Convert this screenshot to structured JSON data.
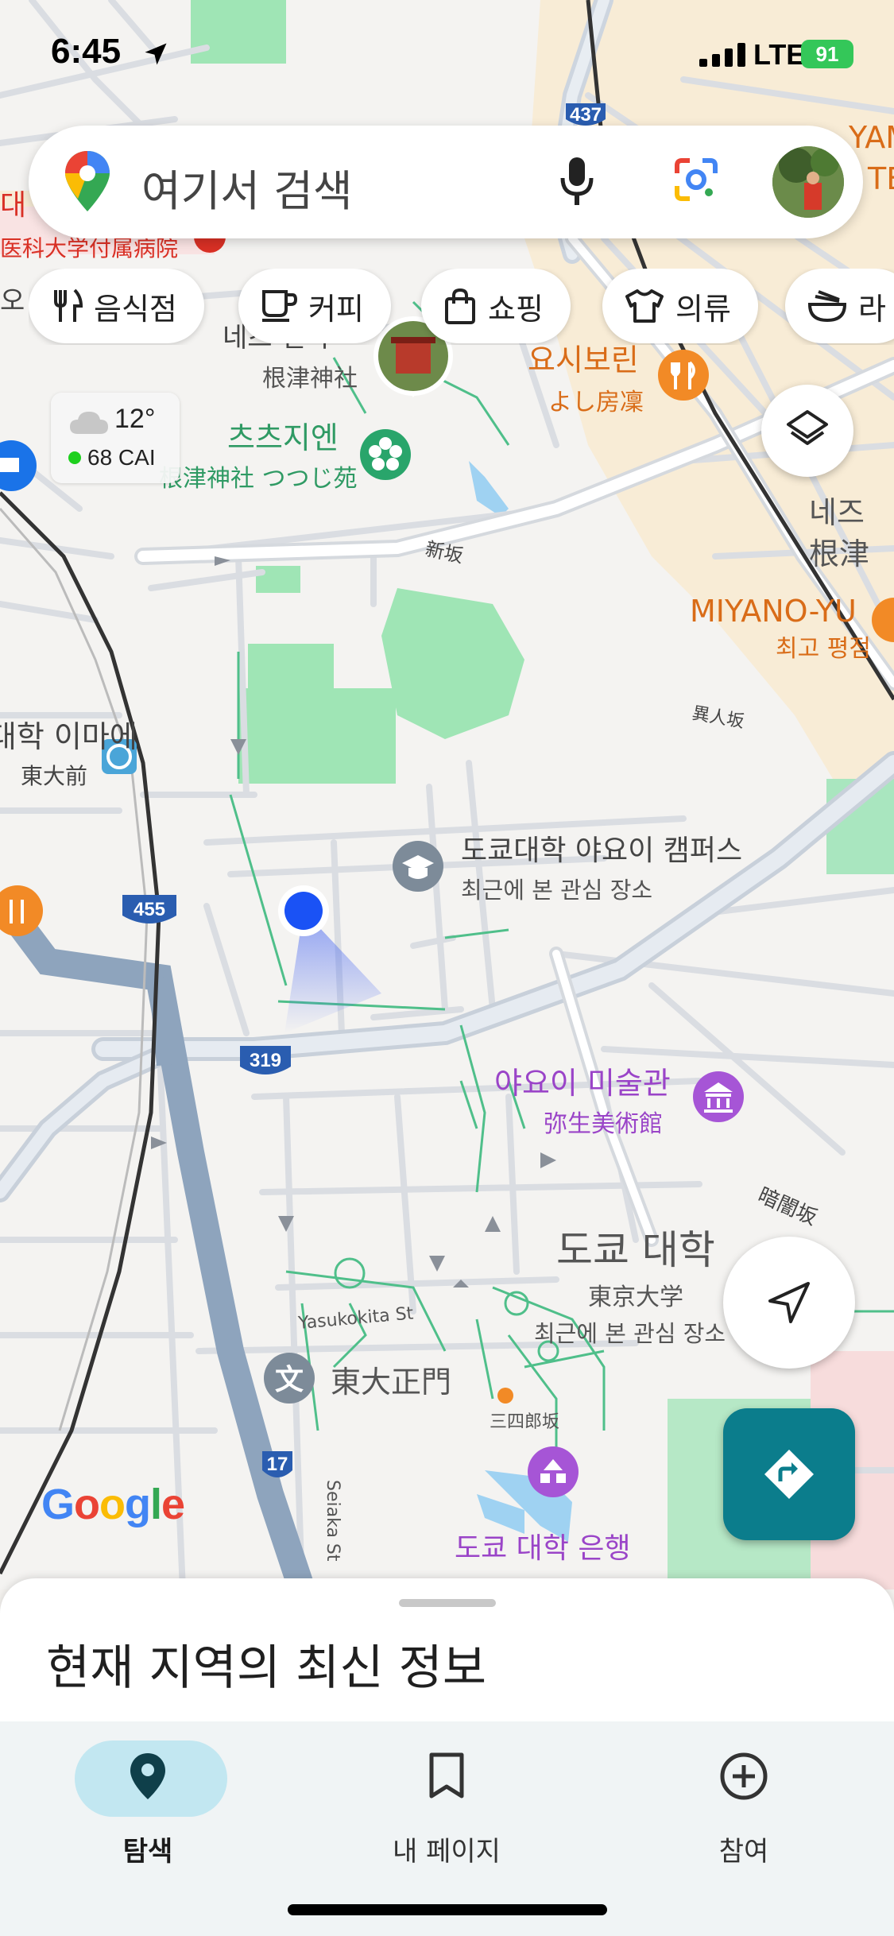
{
  "status_bar": {
    "time": "6:45",
    "network": "LTE",
    "battery": "91"
  },
  "search": {
    "placeholder": "여기서 검색"
  },
  "chips": [
    {
      "label": "음식점",
      "icon": "fork-knife-icon"
    },
    {
      "label": "커피",
      "icon": "coffee-cup-icon"
    },
    {
      "label": "쇼핑",
      "icon": "shopping-bag-icon"
    },
    {
      "label": "의류",
      "icon": "tshirt-icon"
    },
    {
      "label": "라",
      "icon": "noodle-bowl-icon"
    }
  ],
  "weather": {
    "temperature": "12°",
    "air_quality": "68 CAI"
  },
  "map_labels": {
    "hospital": "医科大学付属病院",
    "hospital_ko": "대",
    "o_left": "오",
    "nezu_shrine_ko": "네즈 신사",
    "nezu_shrine_jp": "根津神社",
    "tsutsuji_ko": "츠츠지엔",
    "tsutsuji_jp": "根津神社 つつじ苑",
    "yoshibori_ko": "요시보린",
    "yoshibori_jp": "よし房凜",
    "nezu_ko": "네즈",
    "nezu_jp": "根津",
    "miyano_yu": "MIYANO-YU",
    "miyano_sub": "최고 평점",
    "shinzaka": "新坂",
    "ijinzaka": "異人坂",
    "todaimae_ko": "도쿄대학 이마에",
    "todaimae_jp": "東大前",
    "yayoi_campus": "도쿄대학 야요이 캠퍼스",
    "yayoi_campus_sub": "최근에 본 관심 장소",
    "yayoi_museum_ko": "야요이 미술관",
    "yayoi_museum_jp": "弥生美術館",
    "kurayamizaka": "暗闇坂",
    "univ_ko": "도쿄 대학",
    "univ_jp": "東京大学",
    "univ_sub": "최근에 본 관심 장소",
    "yasukokita": "Yasukokita St",
    "seimon": "東大正門",
    "sanshiro": "三四郎坂",
    "bank": "도쿄 대학 은행",
    "seiaka": "Seiaka St",
    "yama": "YAM",
    "te": "TE",
    "route_437": "437",
    "route_455": "455",
    "route_319": "319",
    "route_17": "17",
    "google": "Google"
  },
  "bottom_sheet": {
    "title": "현재 지역의 최신 정보"
  },
  "bottom_nav": [
    {
      "label": "탐색",
      "icon": "location-pin-icon",
      "active": true
    },
    {
      "label": "내 페이지",
      "icon": "bookmark-icon",
      "active": false
    },
    {
      "label": "참여",
      "icon": "add-circle-icon",
      "active": false
    }
  ],
  "colors": {
    "accent": "#0b7d8c",
    "active_pill": "#c2e7f1",
    "user_dot": "#1a52f5"
  }
}
